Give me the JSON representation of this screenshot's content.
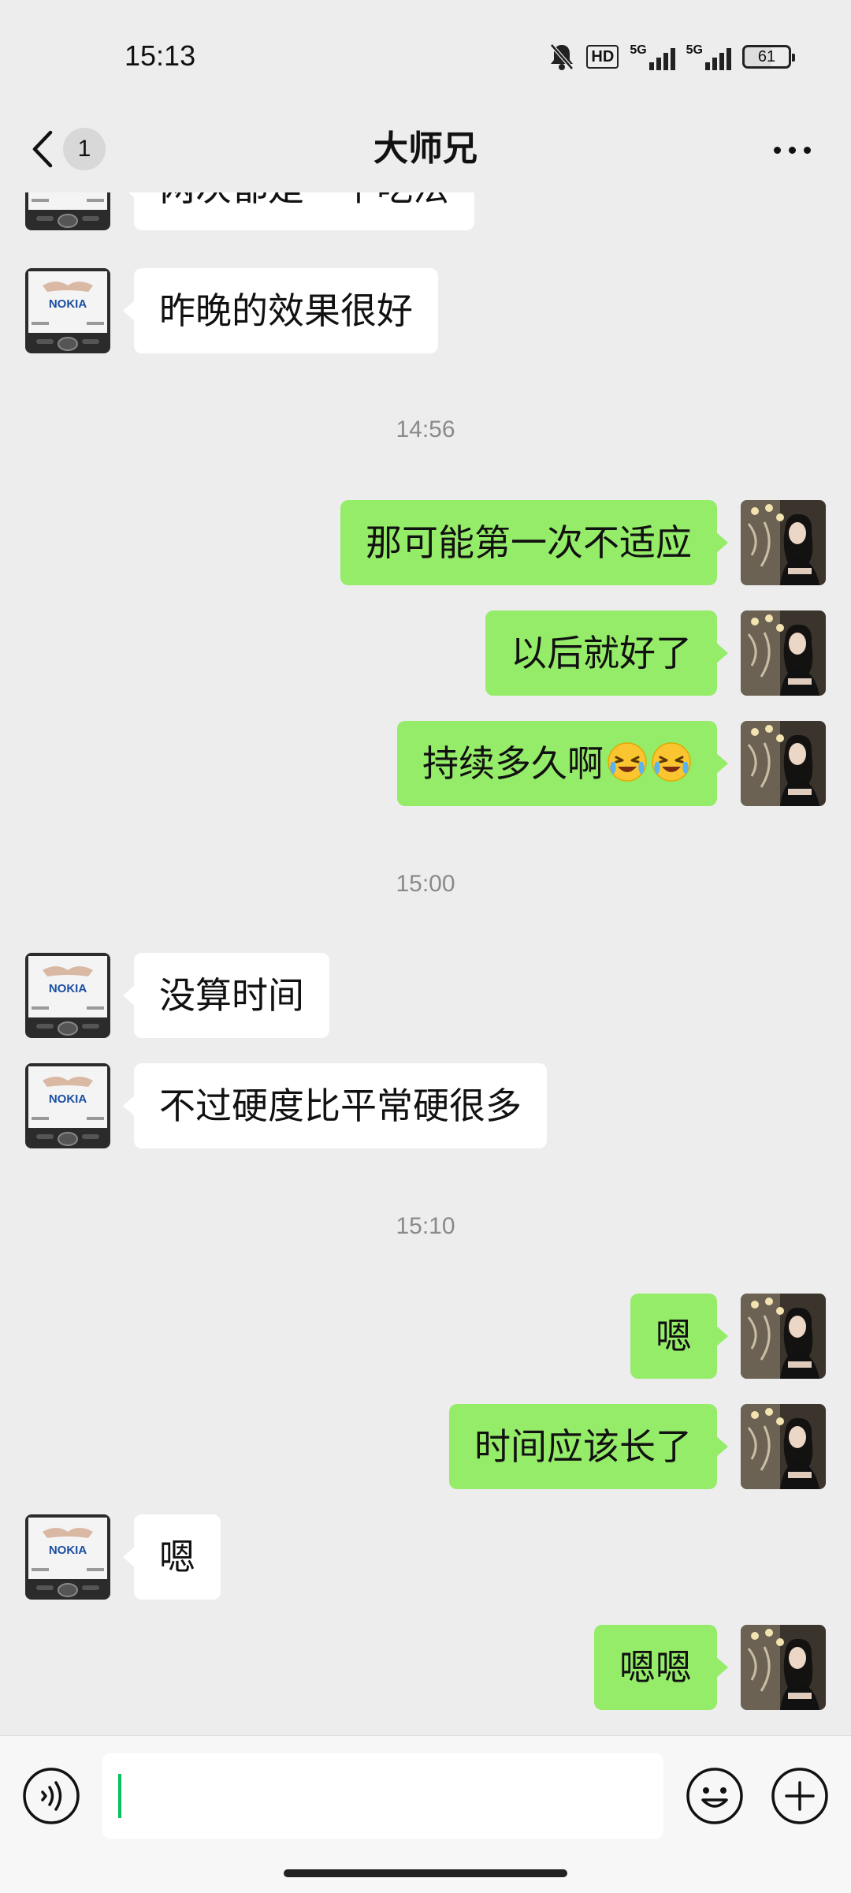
{
  "status_bar": {
    "time": "15:13",
    "network_1": "5G",
    "network_2": "5G",
    "hd_label": "HD",
    "battery": "61"
  },
  "nav": {
    "unread_count": "1",
    "title": "大师兄"
  },
  "messages": [
    {
      "side": "in",
      "text": "两次都是一个吃法"
    },
    {
      "side": "in",
      "text": "昨晚的效果很好"
    },
    {
      "time": "14:56"
    },
    {
      "side": "out",
      "text": "那可能第一次不适应"
    },
    {
      "side": "out",
      "text": "以后就好了"
    },
    {
      "side": "out",
      "text": "持续多久啊",
      "emojis": [
        "laughing-crying-emoji",
        "laughing-crying-emoji"
      ]
    },
    {
      "time": "15:00"
    },
    {
      "side": "in",
      "text": "没算时间"
    },
    {
      "side": "in",
      "text": "不过硬度比平常硬很多"
    },
    {
      "time": "15:10"
    },
    {
      "side": "out",
      "text": "嗯"
    },
    {
      "side": "out",
      "text": "时间应该长了"
    },
    {
      "side": "in",
      "text": "嗯"
    },
    {
      "side": "out",
      "text": "嗯嗯"
    }
  ],
  "contact_avatar_brand": "NOKIA",
  "input": {
    "value": "",
    "placeholder": ""
  },
  "colors": {
    "outgoing_bubble": "#95ec69",
    "incoming_bubble": "#ffffff",
    "background": "#ededed",
    "caret": "#07c160"
  }
}
